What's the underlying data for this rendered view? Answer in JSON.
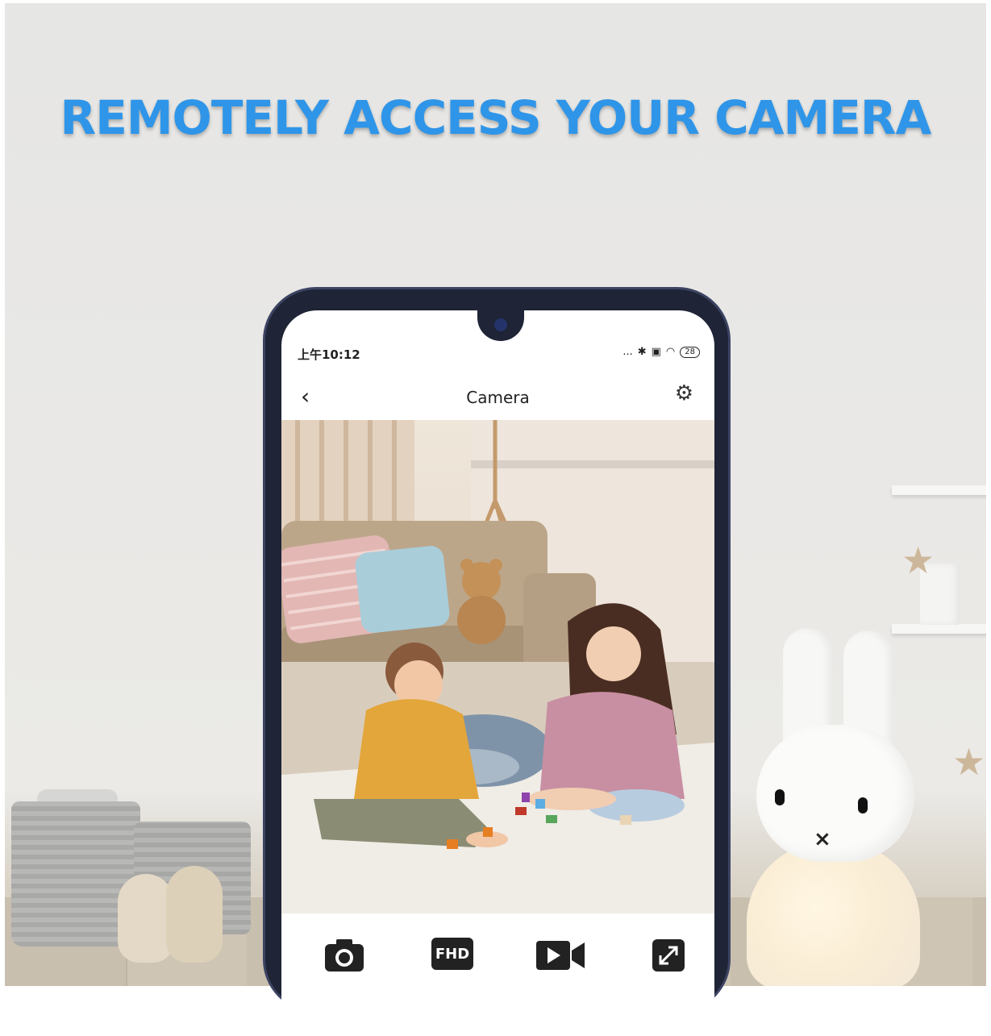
{
  "headline": "REMOTELY ACCESS YOUR CAMERA",
  "phone": {
    "status_time": "上午10:12",
    "status_dots": "...",
    "battery": "28",
    "title": "Camera",
    "controls": [
      {
        "name": "snapshot",
        "icon": "camera-icon"
      },
      {
        "name": "quality",
        "icon": "fhd-icon",
        "label": "FHD"
      },
      {
        "name": "record",
        "icon": "video-icon"
      },
      {
        "name": "fullscreen",
        "icon": "expand-icon"
      }
    ]
  },
  "colors": {
    "headline": "#2f95e8",
    "phone_frame": "#1f2436",
    "screen_bg": "#ffffff"
  }
}
